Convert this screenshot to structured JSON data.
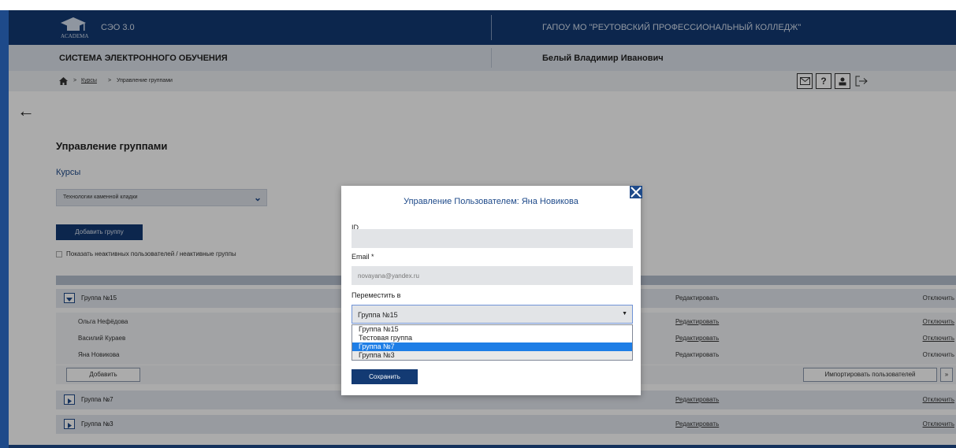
{
  "header": {
    "logo_text": "ACADEMA",
    "app_name": "СЭО 3.0",
    "college": "ГАПОУ МО \"РЕУТОВСКИЙ ПРОФЕССИОНАЛЬНЫЙ КОЛЛЕДЖ\"",
    "system_title": "СИСТЕМА ЭЛЕКТРОННОГО ОБУЧЕНИЯ",
    "user_name": "Белый Владимир Иванович"
  },
  "breadcrumb": {
    "items": [
      "Курсы",
      "Управление группами"
    ],
    "separator": ">"
  },
  "toolbar": {
    "help_glyph": "?"
  },
  "page": {
    "title": "Управление группами",
    "courses_label": "Курсы",
    "course_selected": "Технологии каменной кладки",
    "add_group_label": "Добавить группу",
    "show_inactive_label": "Показать неактивных пользователей / неактивные группы"
  },
  "table": {
    "edit_label": "Редактировать",
    "disable_label": "Отключить",
    "add_label": "Добавить",
    "import_label": "Импортировать пользователей",
    "more_label": "»",
    "groups": [
      {
        "name": "Группа №15",
        "members": [
          "Ольга Нефёдова",
          "Василий Кураев",
          "Яна Новикова"
        ]
      },
      {
        "name": "Группа №7"
      },
      {
        "name": "Группа №3"
      }
    ]
  },
  "modal": {
    "title": "Управление Пользователем: Яна Новикова",
    "id_label": "ID",
    "id_value": "",
    "email_label": "Email *",
    "email_value": "novayana@yandex.ru",
    "move_label": "Переместить в",
    "move_selected": "Группа №15",
    "options": [
      "Группа №15",
      "Тестовая группа",
      "Группа №7",
      "Группа №3"
    ],
    "highlighted_option": "Группа №7",
    "save_label": "Сохранить"
  },
  "colors": {
    "brand": "#133a73",
    "accent": "#1e4a8a",
    "highlight": "#1e7ee6"
  }
}
